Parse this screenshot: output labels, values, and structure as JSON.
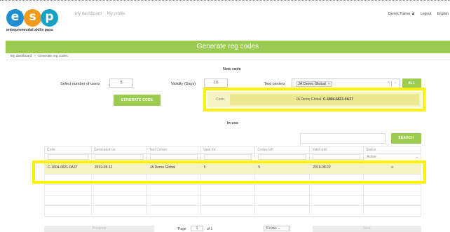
{
  "brand": {
    "letters": [
      "e",
      "s",
      "p"
    ],
    "tagline": "entrepreneurial skills pass",
    "colors": {
      "e": "#1f8fcf",
      "s": "#f19b1d",
      "p": "#17a2c5"
    }
  },
  "topnav": {
    "dashboard": "My dashboard",
    "profile": "My profile"
  },
  "toplinks": {
    "user": "Demot Trainer",
    "user_icon": "user-icon",
    "logout": "Logout",
    "language": "English"
  },
  "page": {
    "title": "Generate reg codes",
    "accent": "#9bcb51"
  },
  "breadcrumb": {
    "home": "My dashboard",
    "separator": ">",
    "current": "Generate reg codes"
  },
  "new_code": {
    "section_title": "New code",
    "users_label": "Select number of users",
    "users_value": "5",
    "validity_label": "Validity (Days)",
    "validity_value": "10",
    "test_centers_label": "Test centers",
    "test_center_chip": "JA Demo Global",
    "chip_remove": "×",
    "clear": "×",
    "caret": "⌄",
    "all_button": "ALL",
    "generate_button": "GENERATE CODE",
    "code_label": "Code:",
    "code_center": "JA Demo Global:",
    "code_value": "C-1804-6821-0A37"
  },
  "in_use": {
    "section_title": "In use",
    "search_button": "SEARCH",
    "columns": [
      "Code",
      "Generated on",
      "Test Center",
      "Valid for",
      "Codes left",
      "Valid until",
      "Status"
    ],
    "status_filter": "Active",
    "status_caret": "⌄",
    "rows": [
      {
        "code": "C-1804-6821-0A37",
        "generated_on": "2019-08-12",
        "test_center": "JA Demo Global",
        "valid_for": "5",
        "codes_left": "5",
        "valid_until": "2019-08-22",
        "status_icon": "check-circle-icon",
        "status_glyph": "⊘"
      }
    ]
  },
  "pager": {
    "previous": "Previous",
    "page_label": "Page",
    "page_value": "1",
    "of_label": "of 1",
    "rows_option": "5 rows",
    "rows_caret": "⌄",
    "next": "Next"
  },
  "highlight_color": "#fff200"
}
